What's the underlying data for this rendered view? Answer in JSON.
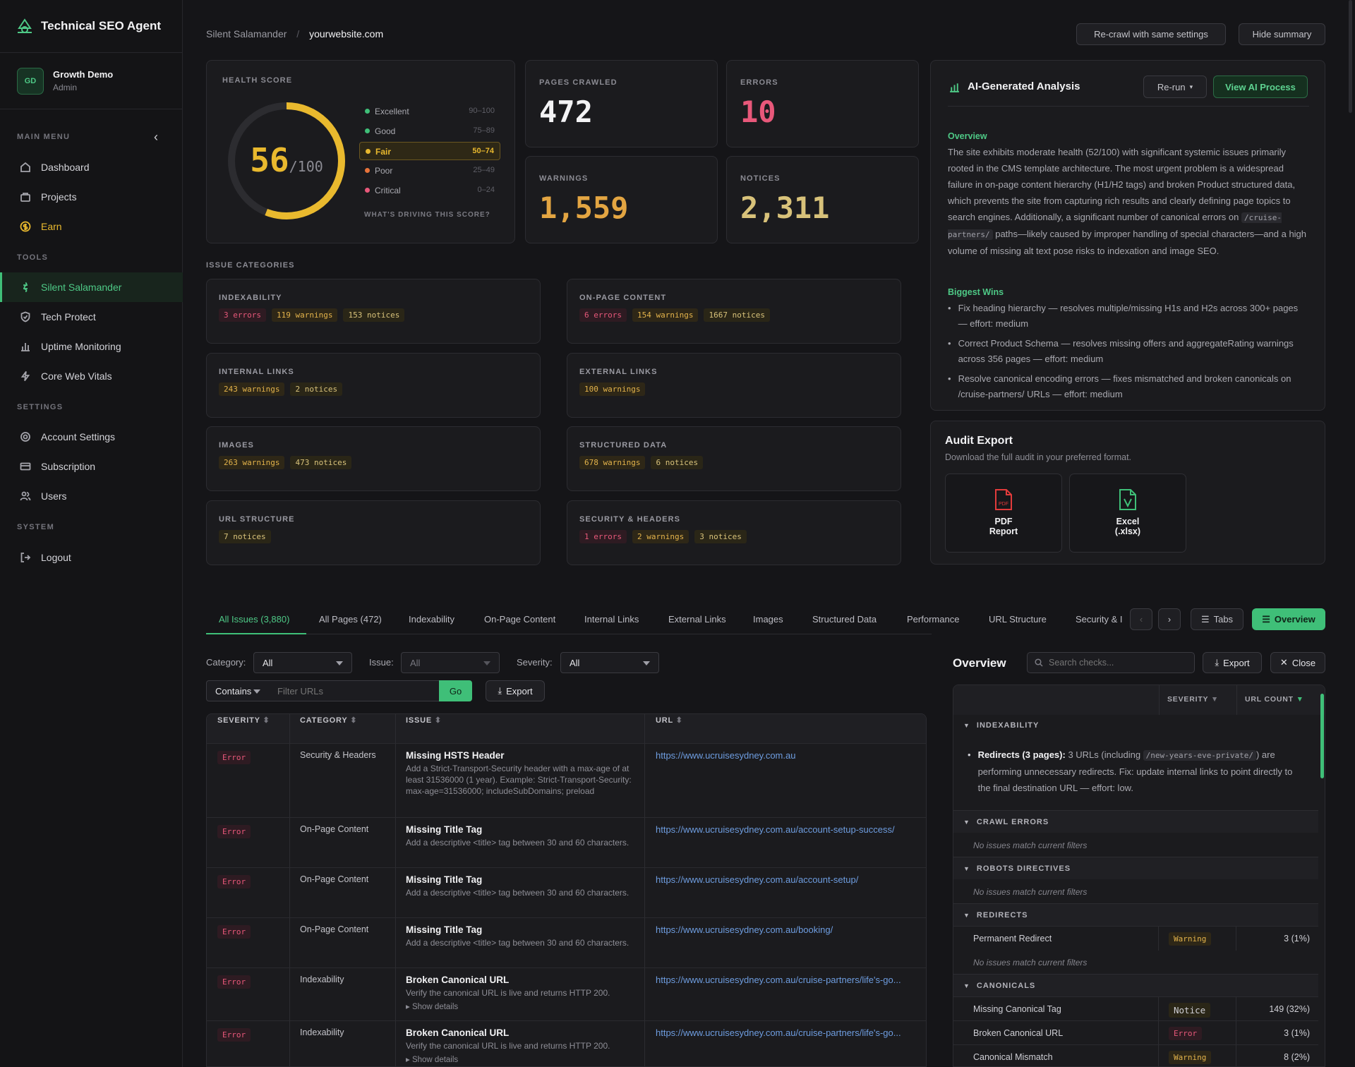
{
  "app": {
    "title": "Technical SEO Agent"
  },
  "user": {
    "initials": "GD",
    "name": "Growth Demo",
    "role": "Admin"
  },
  "sidebar": {
    "main_label": "MAIN MENU",
    "tools_label": "TOOLS",
    "settings_label": "SETTINGS",
    "system_label": "SYSTEM",
    "main": [
      "Dashboard",
      "Projects",
      "Earn"
    ],
    "tools": [
      "Silent Salamander",
      "Tech Protect",
      "Uptime Monitoring",
      "Core Web Vitals"
    ],
    "settings": [
      "Account Settings",
      "Subscription",
      "Users"
    ],
    "system": [
      "Logout"
    ]
  },
  "breadcrumb": {
    "project": "Silent Salamander",
    "sep": "/",
    "site": "yourwebsite.com"
  },
  "header": {
    "recrawl": "Re-crawl with same settings",
    "hide_summary": "Hide summary"
  },
  "health": {
    "label": "HEALTH SCORE",
    "score": "56",
    "max": "/100",
    "score_fraction": 0.56,
    "legend": [
      {
        "name": "Excellent",
        "range": "90–100",
        "color": "#3fbf78"
      },
      {
        "name": "Good",
        "range": "75–89",
        "color": "#3fbf78"
      },
      {
        "name": "Fair",
        "range": "50–74",
        "color": "#e9b92e"
      },
      {
        "name": "Poor",
        "range": "25–49",
        "color": "#e8733a"
      },
      {
        "name": "Critical",
        "range": "0–24",
        "color": "#e8587a"
      }
    ],
    "driving": "WHAT'S DRIVING THIS SCORE?"
  },
  "stats": {
    "pages_label": "PAGES CRAWLED",
    "pages": "472",
    "errors_label": "ERRORS",
    "errors": "10",
    "warnings_label": "WARNINGS",
    "warnings": "1,559",
    "notices_label": "NOTICES",
    "notices": "2,311"
  },
  "ai": {
    "title": "AI-Generated Analysis",
    "rerun": "Re-run",
    "view": "View AI Process",
    "overview_h": "Overview",
    "overview_a": "The site exhibits moderate health (52/100) with significant systemic issues primarily rooted in the CMS template architecture. The most urgent problem is a widespread failure in on-page content hierarchy (H1/H2 tags) and broken Product structured data, which prevents the site from capturing rich results and clearly defining page topics to search engines. Additionally, a significant number of canonical errors on ",
    "overview_code": "/cruise-partners/",
    "overview_b": " paths—likely caused by improper handling of special characters—and a high volume of missing alt text pose risks to indexation and image SEO.",
    "wins_h": "Biggest Wins",
    "wins": [
      "Fix heading hierarchy — resolves multiple/missing H1s and H2s across 300+ pages — effort: medium",
      "Correct Product Schema — resolves missing offers and aggregateRating warnings across 356 pages — effort: medium",
      "Resolve canonical encoding errors — fixes mismatched and broken canonicals on /cruise-partners/ URLs — effort: medium"
    ]
  },
  "export": {
    "title": "Audit Export",
    "sub": "Download the full audit in your preferred format.",
    "pdf_l1": "PDF",
    "pdf_l2": "Report",
    "pdf_icon": "PDF",
    "xls_l1": "Excel",
    "xls_l2": "(.xlsx)"
  },
  "categories": {
    "label": "ISSUE CATEGORIES",
    "items": [
      {
        "name": "INDEXABILITY",
        "e": "3 errors",
        "w": "119 warnings",
        "n": "153 notices"
      },
      {
        "name": "ON-PAGE CONTENT",
        "e": "6 errors",
        "w": "154 warnings",
        "n": "1667 notices"
      },
      {
        "name": "INTERNAL LINKS",
        "w": "243 warnings",
        "n": "2 notices"
      },
      {
        "name": "EXTERNAL LINKS",
        "w": "100 warnings"
      },
      {
        "name": "IMAGES",
        "w": "263 warnings",
        "n": "473 notices"
      },
      {
        "name": "STRUCTURED DATA",
        "w": "678 warnings",
        "n": "6 notices"
      },
      {
        "name": "URL STRUCTURE",
        "n": "7 notices"
      },
      {
        "name": "SECURITY & HEADERS",
        "e": "1 errors",
        "w": "2 warnings",
        "n": "3 notices"
      }
    ]
  },
  "tabs": {
    "items": [
      "All Issues (3,880)",
      "All Pages (472)",
      "Indexability",
      "On-Page Content",
      "Internal Links",
      "External Links",
      "Images",
      "Structured Data",
      "Performance",
      "URL Structure",
      "Security & I"
    ],
    "tabs_btn": "Tabs",
    "overview_btn": "Overview"
  },
  "filters": {
    "category_label": "Category:",
    "category": "All",
    "issue_label": "Issue:",
    "issue": "All",
    "severity_label": "Severity:",
    "severity": "All",
    "contains": "Contains",
    "filter_placeholder": "Filter URLs",
    "go": "Go",
    "export": "Export"
  },
  "table": {
    "headers": [
      "SEVERITY",
      "CATEGORY",
      "ISSUE",
      "URL"
    ],
    "rows": [
      {
        "sev": "Error",
        "cat": "Security & Headers",
        "title": "Missing HSTS Header",
        "desc": "Add a Strict-Transport-Security header with a max-age of at least 31536000 (1 year). Example: Strict-Transport-Security: max-age=31536000; includeSubDomains; preload",
        "url": "https://www.ucruisesydney.com.au"
      },
      {
        "sev": "Error",
        "cat": "On-Page Content",
        "title": "Missing Title Tag",
        "desc": "Add a descriptive <title> tag between 30 and 60 characters.",
        "url": "https://www.ucruisesydney.com.au/account-setup-success/"
      },
      {
        "sev": "Error",
        "cat": "On-Page Content",
        "title": "Missing Title Tag",
        "desc": "Add a descriptive <title> tag between 30 and 60 characters.",
        "url": "https://www.ucruisesydney.com.au/account-setup/"
      },
      {
        "sev": "Error",
        "cat": "On-Page Content",
        "title": "Missing Title Tag",
        "desc": "Add a descriptive <title> tag between 30 and 60 characters.",
        "url": "https://www.ucruisesydney.com.au/booking/"
      },
      {
        "sev": "Error",
        "cat": "Indexability",
        "title": "Broken Canonical URL",
        "desc": "Verify the canonical URL is live and returns HTTP 200.",
        "details": "▸ Show details",
        "url": "https://www.ucruisesydney.com.au/cruise-partners/life's-go..."
      },
      {
        "sev": "Error",
        "cat": "Indexability",
        "title": "Broken Canonical URL",
        "desc": "Verify the canonical URL is live and returns HTTP 200.",
        "details": "▸ Show details",
        "url": "https://www.ucruisesydney.com.au/cruise-partners/life's-go..."
      }
    ]
  },
  "overview": {
    "title": "Overview",
    "search_placeholder": "Search checks...",
    "export": "Export",
    "close": "Close",
    "col_sev": "SEVERITY",
    "col_count": "URL COUNT",
    "indexability": "INDEXABILITY",
    "redirect_bold": "Redirects (3 pages):",
    "redirect_a": " 3 URLs (including ",
    "redirect_code": "/new-years-eve-private/",
    "redirect_b": ") are performing unnecessary redirects. Fix: update internal links to point directly to the final destination URL — effort: low.",
    "g_crawl": "CRAWL ERRORS",
    "g_robots": "ROBOTS DIRECTIVES",
    "g_redirects": "REDIRECTS",
    "g_canon": "CANONICALS",
    "empty": "No issues match current filters",
    "perm": {
      "name": "Permanent Redirect",
      "sev": "Warning",
      "count": "3 (1%)"
    },
    "canon": [
      {
        "name": "Missing Canonical Tag",
        "sev": "Notice",
        "count": "149 (32%)"
      },
      {
        "name": "Broken Canonical URL",
        "sev": "Error",
        "count": "3 (1%)"
      },
      {
        "name": "Canonical Mismatch",
        "sev": "Warning",
        "count": "8 (2%)"
      }
    ]
  }
}
